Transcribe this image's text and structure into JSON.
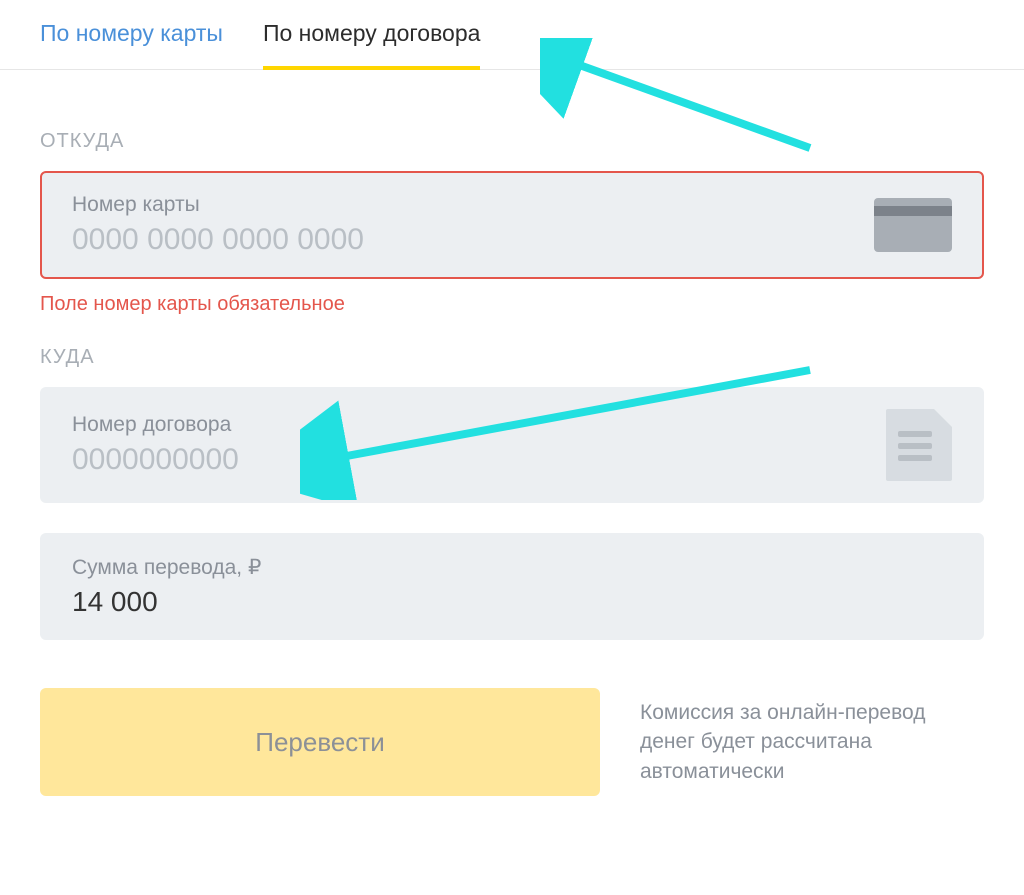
{
  "tabs": {
    "card": "По номеру карты",
    "contract": "По номеру договора"
  },
  "from": {
    "section": "ОТКУДА",
    "label": "Номер карты",
    "placeholder": "0000 0000 0000 0000",
    "value": "",
    "error": "Поле номер карты обязательное"
  },
  "to": {
    "section": "КУДА",
    "label": "Номер договора",
    "placeholder": "0000000000",
    "value": ""
  },
  "amount": {
    "label": "Сумма перевода, ₽",
    "value": "14 000"
  },
  "button": "Перевести",
  "commission": "Комиссия за онлайн-перевод денег будет рассчитана автоматически",
  "colors": {
    "accent": "#ffd600",
    "error": "#e4564c",
    "arrow": "#22e0e0"
  }
}
